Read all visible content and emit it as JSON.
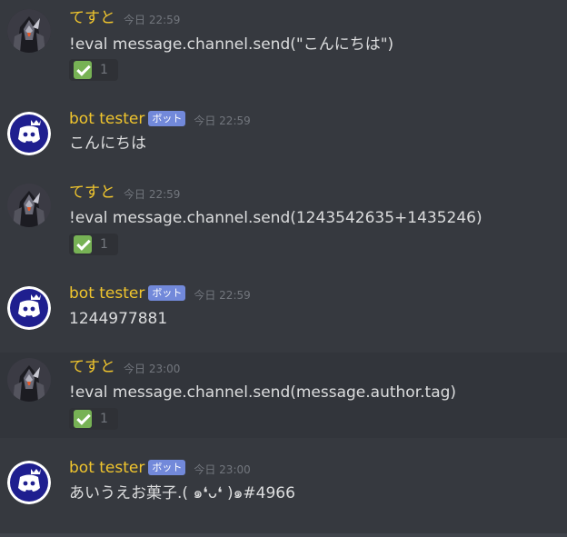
{
  "messages": [
    {
      "username": "てすと",
      "avatar_icon": "dark-armored-character-avatar",
      "is_bot": false,
      "timestamp": "今日 22:59",
      "content": "!eval message.channel.send(\"こんにちは\")",
      "reaction": {
        "emoji": "white-check-mark",
        "count": "1"
      }
    },
    {
      "username": "bot tester",
      "avatar_icon": "discord-bot-avatar",
      "is_bot": true,
      "bot_tag": "ボット",
      "timestamp": "今日 22:59",
      "content": "こんにちは"
    },
    {
      "username": "てすと",
      "avatar_icon": "dark-armored-character-avatar",
      "is_bot": false,
      "timestamp": "今日 22:59",
      "content": "!eval message.channel.send(1243542635+1435246)",
      "reaction": {
        "emoji": "white-check-mark",
        "count": "1"
      }
    },
    {
      "username": "bot tester",
      "avatar_icon": "discord-bot-avatar",
      "is_bot": true,
      "bot_tag": "ボット",
      "timestamp": "今日 22:59",
      "content": "1244977881"
    },
    {
      "username": "てすと",
      "avatar_icon": "dark-armored-character-avatar",
      "is_bot": false,
      "timestamp": "今日 23:00",
      "content": "!eval message.channel.send(message.author.tag)",
      "reaction": {
        "emoji": "white-check-mark",
        "count": "1"
      }
    },
    {
      "username": "bot tester",
      "avatar_icon": "discord-bot-avatar",
      "is_bot": true,
      "bot_tag": "ボット",
      "timestamp": "今日 23:00",
      "content": "あいうえお菓子.( ๑❛ᴗ❛ )๑#4966"
    }
  ],
  "colors": {
    "background": "#36393f",
    "hover_background": "#32353b",
    "username": "#f0c52d",
    "bot_tag": "#7289da",
    "text": "#dcddde",
    "timestamp": "#72767d",
    "reaction_bg": "#2f3136",
    "check_green": "#77b255",
    "discord_blurple": "#7289da"
  }
}
